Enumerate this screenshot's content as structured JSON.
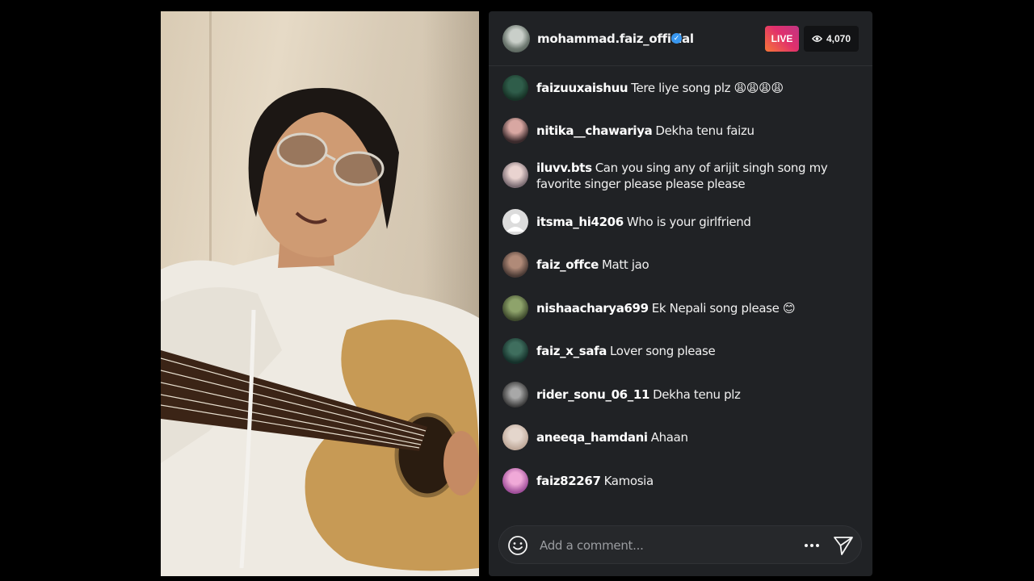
{
  "header": {
    "username": "mohammad.faiz_official",
    "verified": true,
    "live_label": "LIVE",
    "viewer_count": "4,070",
    "colors": {
      "live_gradient_start": "#f77737",
      "live_gradient_end": "#c13584",
      "verified": "#3897f0"
    }
  },
  "video": {
    "icon": "live-video-feed"
  },
  "comments": [
    {
      "user": "faizuuxaishuu",
      "text": "Tere liye song plz 😩😩😩😩"
    },
    {
      "user": "nitika__chawariya",
      "text": "Dekha tenu faizu"
    },
    {
      "user": "iluvv.bts",
      "text": "Can you sing any of arijit singh song my favorite singer please please please"
    },
    {
      "user": "itsma_hi4206",
      "text": "Who is your girlfriend"
    },
    {
      "user": "faiz_offce",
      "text": "Matt jao"
    },
    {
      "user": "nishaacharya699",
      "text": "Ek Nepali song please 😊"
    },
    {
      "user": "faiz_x_safa",
      "text": "Lover song please"
    },
    {
      "user": "rider_sonu_06_11",
      "text": "Dekha tenu plz"
    },
    {
      "user": "aneeqa_hamdani",
      "text": "Ahaan"
    },
    {
      "user": "faiz82267",
      "text": "Kamosia"
    }
  ],
  "composer": {
    "placeholder": "Add a comment...",
    "icons": [
      "emoji-icon",
      "more-options-icon",
      "send-icon"
    ]
  },
  "theme": {
    "panel_bg": "#202225",
    "page_bg": "#000000"
  }
}
